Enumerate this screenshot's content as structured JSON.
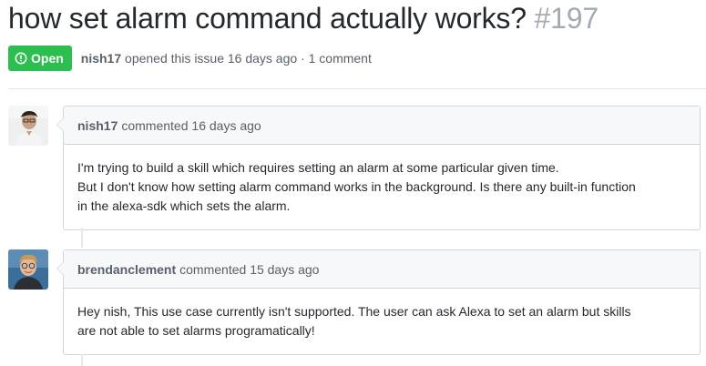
{
  "issue": {
    "title": "how set alarm command actually works?",
    "number": "#197",
    "state_label": "Open",
    "state_color": "#2cbe4e",
    "opened_by": "nish17",
    "opened_text": "opened this issue 16 days ago · 1 comment"
  },
  "comments": [
    {
      "author": "nish17",
      "action": "commented",
      "time": "16 days ago",
      "body": [
        "I'm trying to build a skill which requires setting an alarm at some particular given time.",
        "But I don't know how setting alarm command works in the background. Is there any built-in function",
        "in the alexa-sdk which sets the alarm."
      ]
    },
    {
      "author": "brendanclement",
      "action": "commented",
      "time": "15 days ago",
      "body": [
        "Hey nish, This use case currently isn't supported. The user can ask Alexa to set an alarm but skills",
        "are not able to set alarms programatically!"
      ]
    }
  ]
}
